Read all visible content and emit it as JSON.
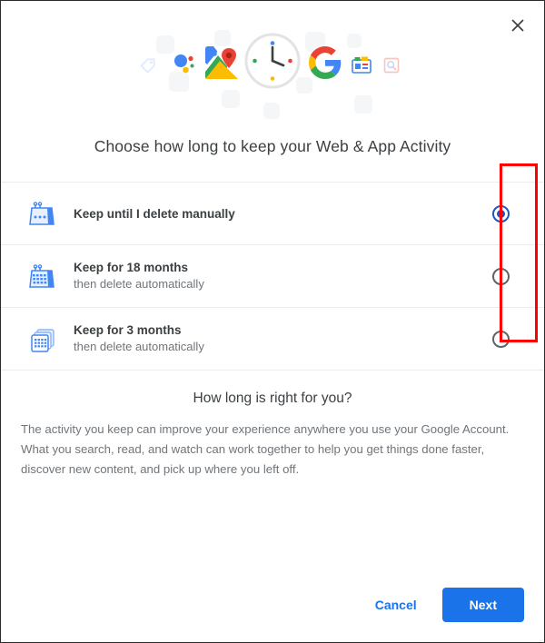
{
  "dialog": {
    "close_icon": "close-icon",
    "title": "Choose how long to keep your Web & App Activity"
  },
  "hero": {
    "icons": [
      {
        "name": "tag-icon",
        "faded": true
      },
      {
        "name": "assistant-dots-icon",
        "faded": false
      },
      {
        "name": "google-maps-icon",
        "faded": false
      },
      {
        "name": "clock-icon",
        "faded": false
      },
      {
        "name": "google-g-icon",
        "faded": false
      },
      {
        "name": "google-news-icon",
        "faded": false
      },
      {
        "name": "photo-search-icon",
        "faded": true
      }
    ],
    "clock_dot_colors": [
      "#4285f4",
      "#ea4335",
      "#fbbc04",
      "#34a853"
    ]
  },
  "options": {
    "selected_index": 0,
    "items": [
      {
        "title": "Keep until I delete manually",
        "subtitle": "",
        "icon": "calendar-dots-icon",
        "selected": true
      },
      {
        "title": "Keep for 18 months",
        "subtitle": "then delete automatically",
        "icon": "calendar-grid-icon",
        "selected": false
      },
      {
        "title": "Keep for 3 months",
        "subtitle": "then delete automatically",
        "icon": "calendar-stack-icon",
        "selected": false
      }
    ]
  },
  "info": {
    "heading": "How long is right for you?",
    "body": "The activity you keep can improve your experience anywhere you use your Google Account. What you search, read, and watch can work together to help you get things done faster, discover new content, and pick up where you left off."
  },
  "footer": {
    "cancel_label": "Cancel",
    "next_label": "Next"
  },
  "colors": {
    "accent_blue": "#1a73e8",
    "radio_selected": "#1a56c4",
    "annotation_red": "#ff0000",
    "text_primary": "#3c4043",
    "text_secondary": "#70757a"
  },
  "annotation": {
    "shape": "rectangle",
    "target": "radio-button-column"
  }
}
